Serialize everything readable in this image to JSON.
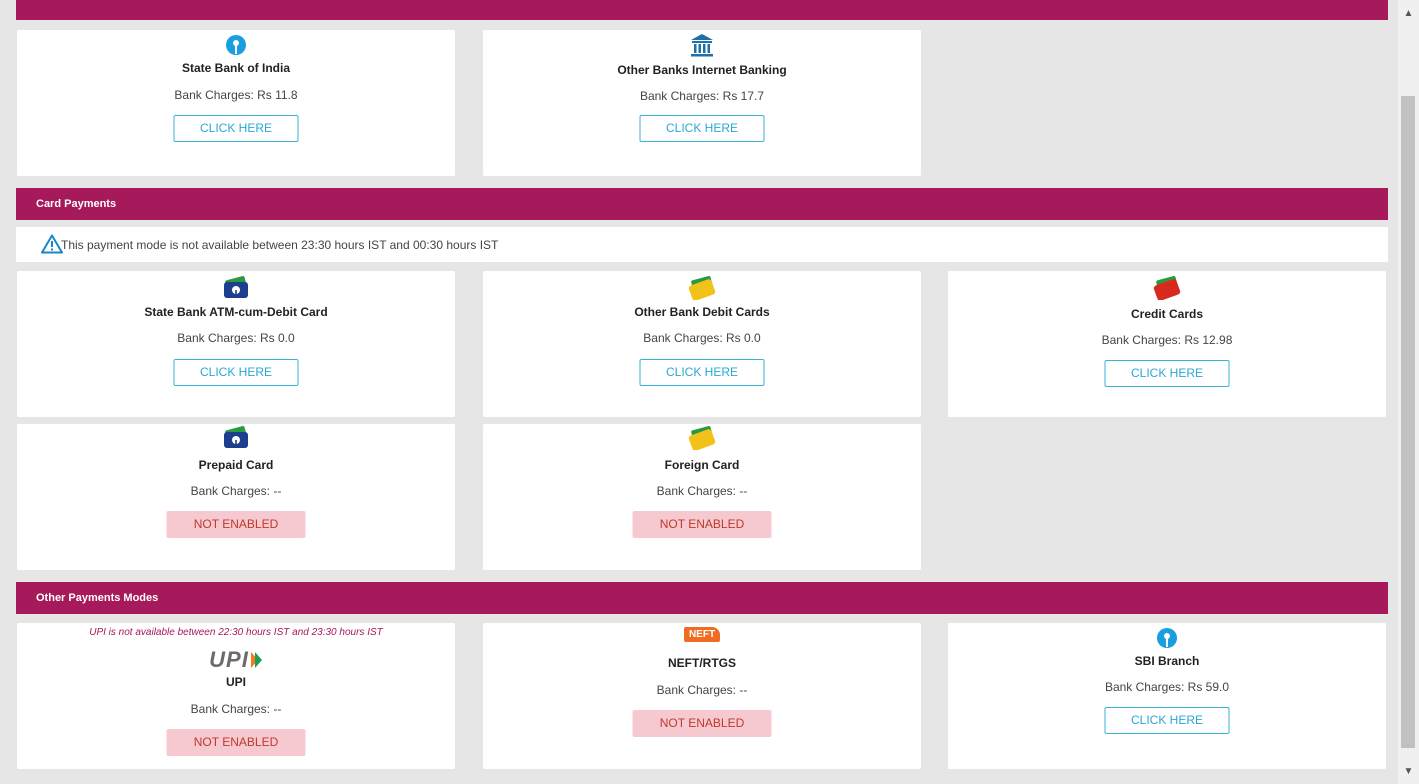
{
  "sections": {
    "card_payments": "Card Payments",
    "other_modes": "Other Payments Modes"
  },
  "notice": "This payment mode is not available between 23:30 hours IST and 00:30 hours IST",
  "net_banking": [
    {
      "title": "State Bank of India",
      "charges": "Bank Charges: Rs 11.8",
      "button": "CLICK HERE",
      "icon": "sbi-logo-icon"
    },
    {
      "title": "Other Banks Internet Banking",
      "charges": "Bank Charges: Rs 17.7",
      "button": "CLICK HERE",
      "icon": "bank-building-icon"
    }
  ],
  "cards": [
    {
      "title": "State Bank ATM-cum-Debit Card",
      "charges": "Bank Charges: Rs 0.0",
      "button": "CLICK HERE",
      "icon": "sbi-card-icon"
    },
    {
      "title": "Other Bank Debit Cards",
      "charges": "Bank Charges: Rs 0.0",
      "button": "CLICK HERE",
      "icon": "yellow-card-icon"
    },
    {
      "title": "Credit Cards",
      "charges": "Bank Charges: Rs 12.98",
      "button": "CLICK HERE",
      "icon": "red-card-icon"
    },
    {
      "title": "Prepaid Card",
      "charges": "Bank Charges: --",
      "button": "NOT ENABLED",
      "icon": "sbi-card-icon"
    },
    {
      "title": "Foreign Card",
      "charges": "Bank Charges: --",
      "button": "NOT ENABLED",
      "icon": "yellow-card-icon"
    }
  ],
  "other": [
    {
      "title": "UPI",
      "charges": "Bank Charges: --",
      "button": "NOT ENABLED",
      "icon": "upi-logo-icon",
      "note": "UPI is not available between 22:30 hours IST and 23:30 hours IST",
      "logo_text": "UPI"
    },
    {
      "title": "NEFT/RTGS",
      "charges": "Bank Charges: --",
      "button": "NOT ENABLED",
      "icon": "neft-logo-icon",
      "logo_text": "NEFT"
    },
    {
      "title": "SBI Branch",
      "charges": "Bank Charges: Rs 59.0",
      "button": "CLICK HERE",
      "icon": "sbi-logo-icon"
    }
  ],
  "colors": {
    "brand": "#a6195a",
    "button_border": "#3bb3d6",
    "disabled_bg": "#f5c9cf",
    "disabled_text": "#c0392b"
  }
}
